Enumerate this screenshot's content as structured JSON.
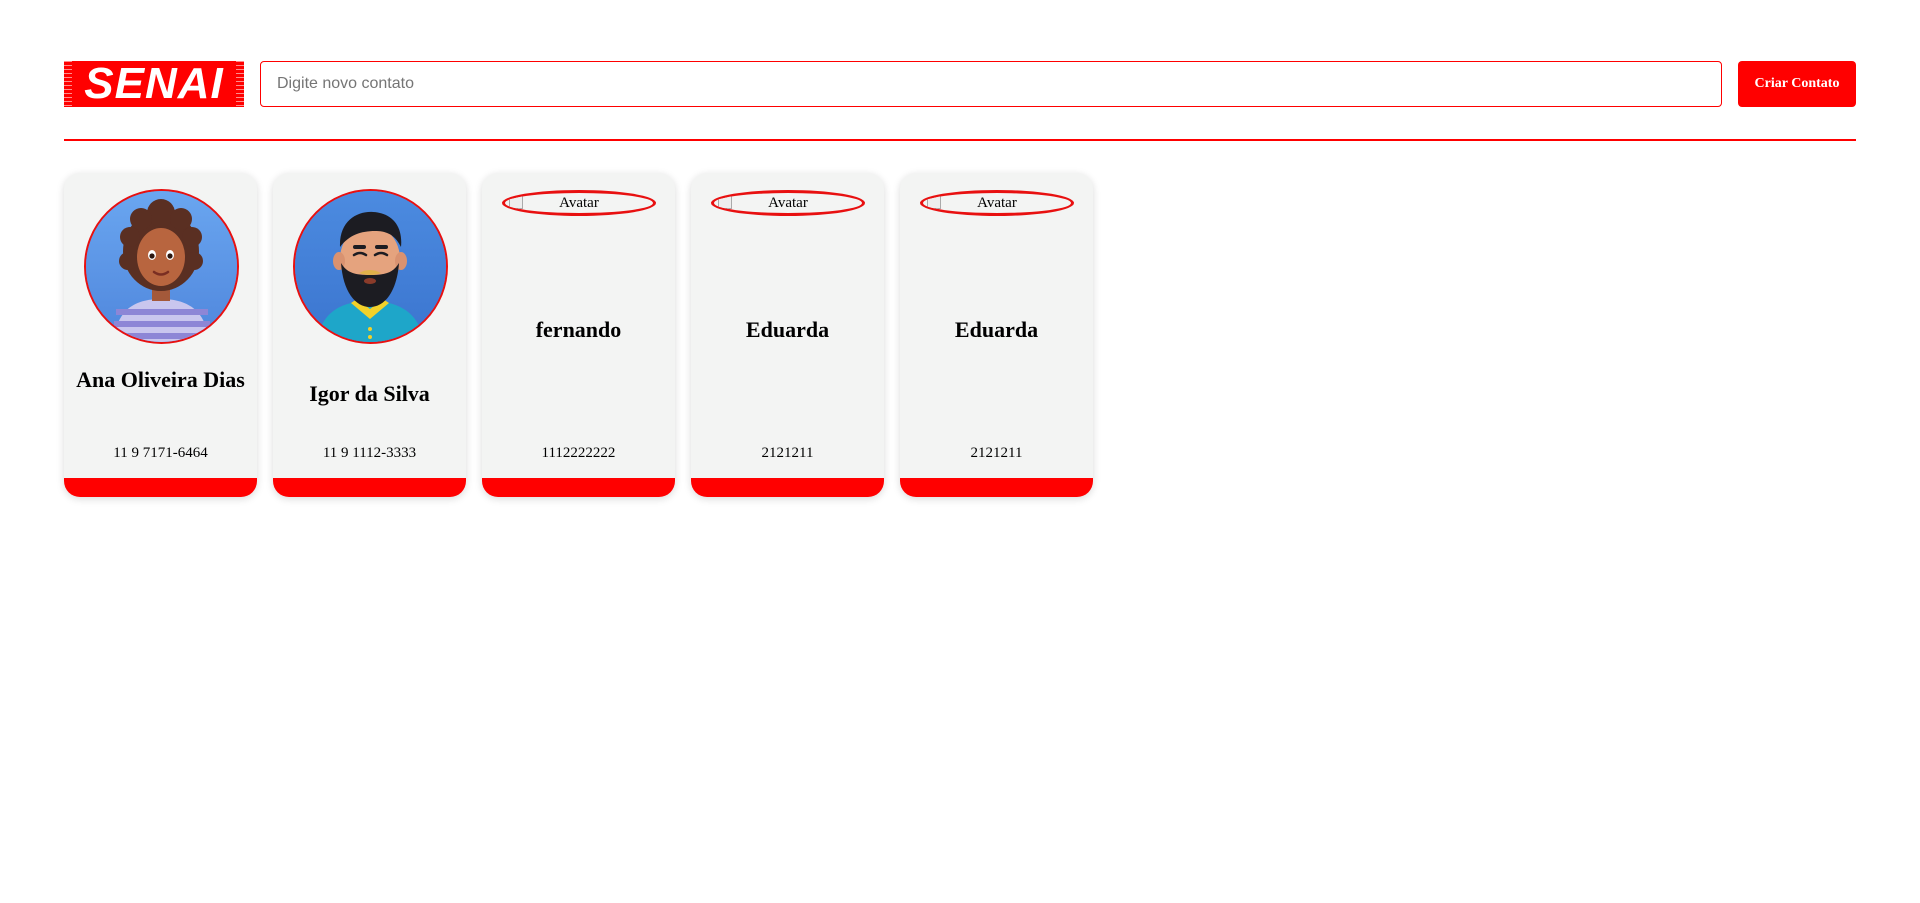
{
  "brand": {
    "logo_text": "SENAI",
    "accent_color": "#ff0000"
  },
  "search": {
    "placeholder": "Digite novo contato",
    "value": ""
  },
  "actions": {
    "create_label": "Criar Contato"
  },
  "contacts": [
    {
      "name": "Ana Oliveira Dias",
      "phone": "11 9 7171-6464",
      "avatar": "woman-avatar-icon",
      "avatar_loaded": true
    },
    {
      "name": "Igor da Silva",
      "phone": "11 9 1112-3333",
      "avatar": "bearded-man-avatar-icon",
      "avatar_loaded": true
    },
    {
      "name": "fernando",
      "phone": "1112222222",
      "avatar_alt": "Avatar",
      "avatar_loaded": false
    },
    {
      "name": "Eduarda",
      "phone": "2121211",
      "avatar_alt": "Avatar",
      "avatar_loaded": false
    },
    {
      "name": "Eduarda",
      "phone": "2121211",
      "avatar_alt": "Avatar",
      "avatar_loaded": false
    }
  ]
}
